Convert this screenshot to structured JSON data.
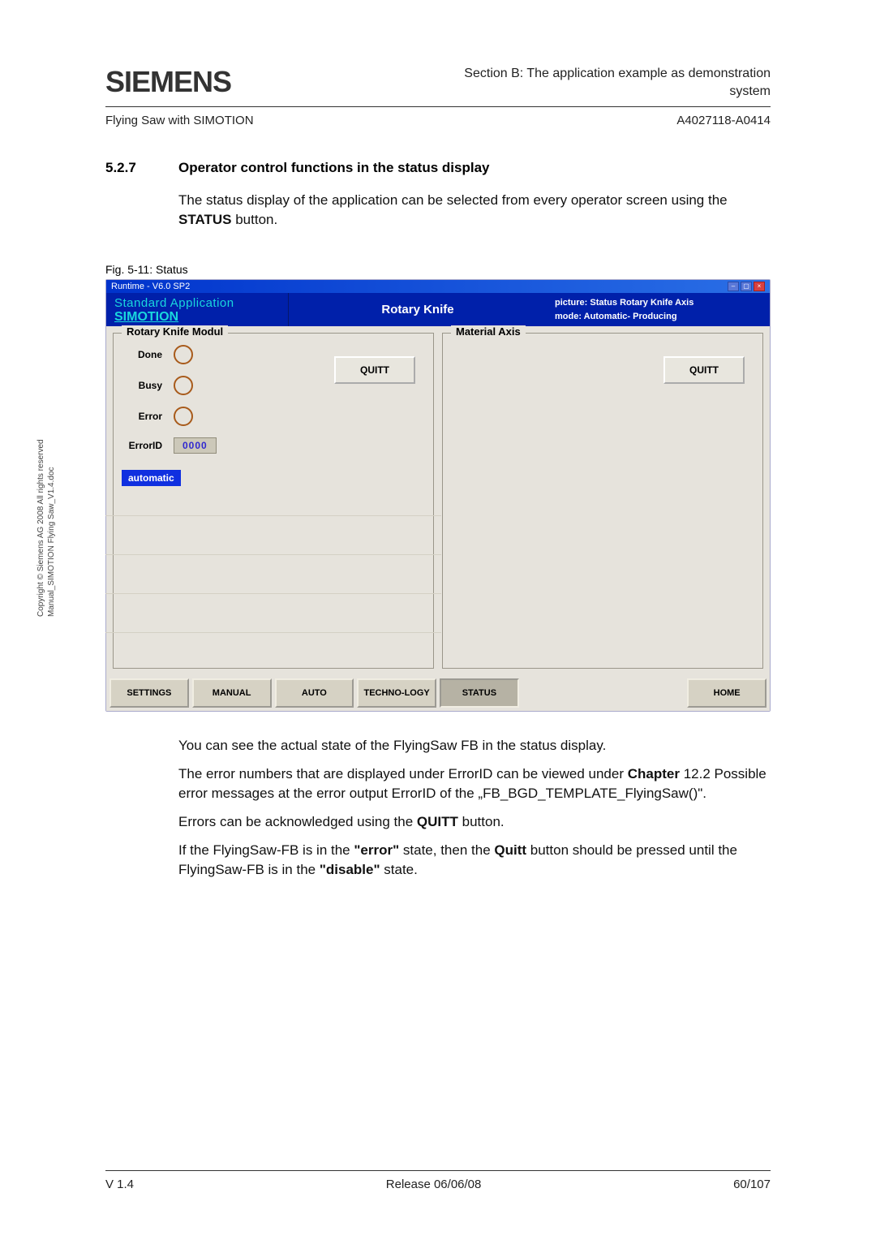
{
  "header": {
    "logo": "SIEMENS",
    "section_line1": "Section B:  The application example as demonstration",
    "section_line2": "system",
    "subleft": "Flying Saw with SIMOTION",
    "subright": "A4027118-A0414"
  },
  "section": {
    "num": "5.2.7",
    "title": "Operator control functions in the status display"
  },
  "body": {
    "p1a": "The status display of the application can be selected from every operator screen using the ",
    "p1b": "STATUS",
    "p1c": " button.",
    "fig": "Fig. 5-11: Status"
  },
  "hmi": {
    "win_title": "Runtime - V6.0 SP2",
    "app_line1": "Standard Application",
    "app_line2": "SIMOTION",
    "title_mid": "Rotary Knife",
    "pic_line": "picture: Status Rotary Knife Axis",
    "mode_line": "mode: Automatic- Producing",
    "panel1_title": "Rotary Knife Modul",
    "panel2_title": "Material Axis",
    "done": "Done",
    "busy": "Busy",
    "error": "Error",
    "errorid": "ErrorID",
    "errid_val": "0000",
    "auto": "automatic",
    "quitt": "QUITT",
    "buttons": {
      "settings": "SETTINGS",
      "manual": "MANUAL",
      "auto": "AUTO",
      "techno": "TECHNO-LOGY",
      "status": "STATUS",
      "home": "HOME"
    }
  },
  "post": {
    "p1": "You can see the actual state of the FlyingSaw FB in the status display.",
    "p2a": "The error numbers that are displayed under ErrorID can be viewed under ",
    "p2b": "Chapter",
    "p2c": " 12.2 Possible error messages at the error output ErrorID of the „FB_BGD_TEMPLATE_FlyingSaw()\".",
    "p3a": "Errors can be acknowledged using the ",
    "p3b": "QUITT",
    "p3c": " button.",
    "p4a": "If the FlyingSaw-FB is in the ",
    "p4b": "\"error\"",
    "p4c": " state, then the ",
    "p4d": "Quitt",
    "p4e": " button should be pressed until the FlyingSaw-FB is in the ",
    "p4f": "\"disable\"",
    "p4g": " state."
  },
  "sidecopy": {
    "line1": "Copyright © Siemens AG 2008 All rights reserved",
    "line2": "Manual_SIMOTION Flying Saw_V1.4.doc"
  },
  "footer": {
    "left": "V 1.4",
    "mid": "Release 06/06/08",
    "right": "60/107"
  }
}
